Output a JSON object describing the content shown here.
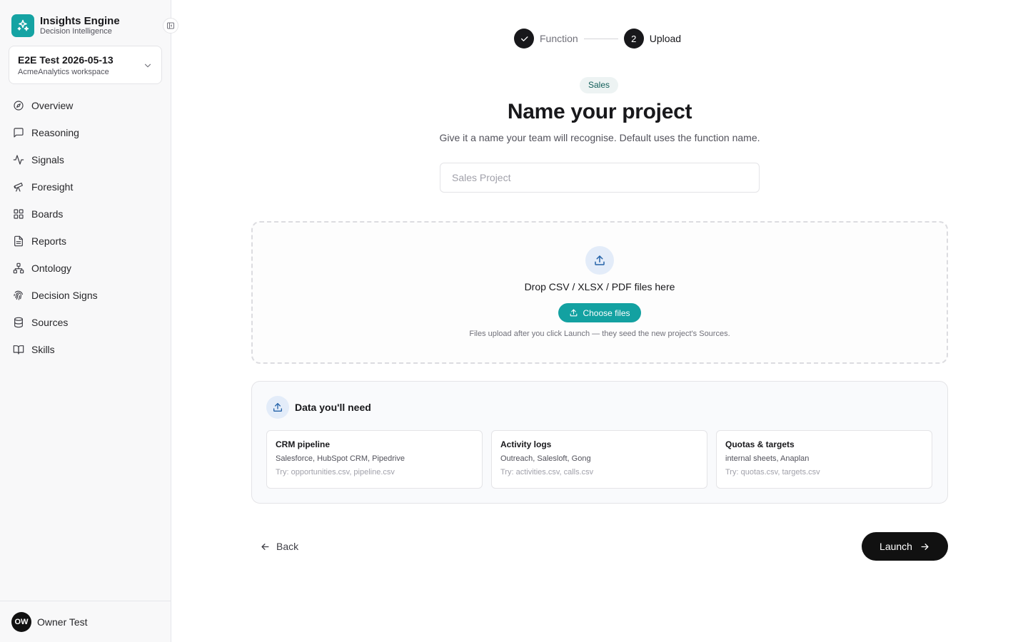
{
  "brand": {
    "name": "Insights Engine",
    "subtitle": "Decision Intelligence",
    "accent": "#15a3a3"
  },
  "workspace": {
    "name": "E2E Test 2026-05-13",
    "subtitle": "AcmeAnalytics workspace"
  },
  "nav": [
    {
      "label": "Overview",
      "icon": "compass-icon"
    },
    {
      "label": "Reasoning",
      "icon": "message-square-icon"
    },
    {
      "label": "Signals",
      "icon": "activity-icon"
    },
    {
      "label": "Foresight",
      "icon": "telescope-icon"
    },
    {
      "label": "Boards",
      "icon": "grid-icon"
    },
    {
      "label": "Reports",
      "icon": "file-text-icon"
    },
    {
      "label": "Ontology",
      "icon": "network-icon"
    },
    {
      "label": "Decision Signs",
      "icon": "fingerprint-icon"
    },
    {
      "label": "Sources",
      "icon": "database-icon"
    },
    {
      "label": "Skills",
      "icon": "book-open-icon"
    }
  ],
  "user": {
    "initials": "OW",
    "name": "Owner Test"
  },
  "stepper": {
    "steps": [
      {
        "label": "Function",
        "state": "complete"
      },
      {
        "number": "2",
        "label": "Upload",
        "state": "active"
      }
    ]
  },
  "main": {
    "tag": "Sales",
    "title": "Name your project",
    "subtitle": "Give it a name your team will recognise. Default uses the function name.",
    "name_input": {
      "value": "",
      "placeholder": "Sales Project"
    }
  },
  "dropzone": {
    "title": "Drop CSV / XLSX / PDF files here",
    "button_label": "Choose files",
    "note": "Files upload after you click Launch — they seed the new project's Sources."
  },
  "needs": {
    "title": "Data you'll need",
    "cards": [
      {
        "title": "CRM pipeline",
        "tools": "Salesforce, HubSpot CRM, Pipedrive",
        "try": "Try: opportunities.csv, pipeline.csv"
      },
      {
        "title": "Activity logs",
        "tools": "Outreach, Salesloft, Gong",
        "try": "Try: activities.csv, calls.csv"
      },
      {
        "title": "Quotas & targets",
        "tools": "internal sheets, Anaplan",
        "try": "Try: quotas.csv, targets.csv"
      }
    ]
  },
  "footer": {
    "back_label": "Back",
    "launch_label": "Launch"
  }
}
